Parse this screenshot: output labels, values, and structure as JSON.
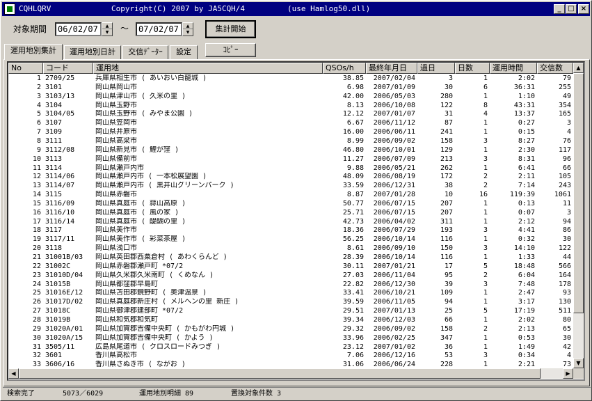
{
  "titlebar": {
    "app": "CQHLQRV",
    "copyright": "Copyright(C) 2007  by JA5CQH/4",
    "use": "(use Hamlog50.dll)",
    "buttons": {
      "minimize": "_",
      "maximize": "□",
      "close": "×"
    }
  },
  "period": {
    "label": "対象期間",
    "from": "06/02/07",
    "sep": "〜",
    "to": "07/02/07",
    "start_button": "集計開始"
  },
  "tabs": [
    "運用地別集計",
    "運用地別日計",
    "交信ﾃﾞｰﾀｰ",
    "設定"
  ],
  "copy_button": "ｺﾋﾟｰ",
  "table": {
    "headers": [
      "No",
      "コード",
      "運用地",
      "QSOs/h",
      "最終年月日",
      "過日",
      "日数",
      "運用時間",
      "交信数"
    ],
    "rows": [
      [
        "1",
        "2709/25",
        "兵庫県相生市 ( あいおい白龍城 )",
        "38.85",
        "2007/02/04",
        "3",
        "1",
        "2:02",
        "79"
      ],
      [
        "2",
        "3101",
        "岡山県岡山市",
        "6.98",
        "2007/01/09",
        "30",
        "6",
        "36:31",
        "255"
      ],
      [
        "3",
        "3103/13",
        "岡山県津山市 ( 久米の里 )",
        "42.00",
        "2006/05/03",
        "280",
        "1",
        "1:10",
        "49"
      ],
      [
        "4",
        "3104",
        "岡山県玉野市",
        "8.13",
        "2006/10/08",
        "122",
        "8",
        "43:31",
        "354"
      ],
      [
        "5",
        "3104/05",
        "岡山県玉野市 ( みやま公園 )",
        "12.12",
        "2007/01/07",
        "31",
        "4",
        "13:37",
        "165"
      ],
      [
        "6",
        "3107",
        "岡山県笠岡市",
        "6.67",
        "2006/11/12",
        "87",
        "1",
        "0:27",
        "3"
      ],
      [
        "7",
        "3109",
        "岡山県井原市",
        "16.00",
        "2006/06/11",
        "241",
        "1",
        "0:15",
        "4"
      ],
      [
        "8",
        "3111",
        "岡山県高梁市",
        "8.99",
        "2006/09/02",
        "158",
        "3",
        "8:27",
        "76"
      ],
      [
        "9",
        "3112/08",
        "岡山県新見市 ( 鯉が窪 )",
        "46.80",
        "2006/10/01",
        "129",
        "1",
        "2:30",
        "117"
      ],
      [
        "10",
        "3113",
        "岡山県備前市",
        "11.27",
        "2006/07/09",
        "213",
        "3",
        "8:31",
        "96"
      ],
      [
        "11",
        "3114",
        "岡山県瀬戸内市",
        "9.88",
        "2006/05/21",
        "262",
        "1",
        "6:41",
        "66"
      ],
      [
        "12",
        "3114/06",
        "岡山県瀬戸内市 ( 一本松展望園 )",
        "48.09",
        "2006/08/19",
        "172",
        "2",
        "2:11",
        "105"
      ],
      [
        "13",
        "3114/07",
        "岡山県瀬戸内市 ( 黒井山グリーンパーク )",
        "33.59",
        "2006/12/31",
        "38",
        "2",
        "7:14",
        "243"
      ],
      [
        "14",
        "3115",
        "岡山県赤磐市",
        "8.87",
        "2007/01/28",
        "10",
        "16",
        "119:39",
        "1061"
      ],
      [
        "15",
        "3116/09",
        "岡山県真庭市 ( 蒜山高原 )",
        "50.77",
        "2006/07/15",
        "207",
        "1",
        "0:13",
        "11"
      ],
      [
        "16",
        "3116/10",
        "岡山県真庭市 ( 風の家 )",
        "25.71",
        "2006/07/15",
        "207",
        "1",
        "0:07",
        "3"
      ],
      [
        "17",
        "3116/14",
        "岡山県真庭市 ( 醍醐の里 )",
        "42.73",
        "2006/04/02",
        "311",
        "1",
        "2:12",
        "94"
      ],
      [
        "18",
        "3117",
        "岡山県美作市",
        "18.36",
        "2006/07/29",
        "193",
        "3",
        "4:41",
        "86"
      ],
      [
        "19",
        "3117/11",
        "岡山県美作市 ( 彩菜茶屋 )",
        "56.25",
        "2006/10/14",
        "116",
        "1",
        "0:32",
        "30"
      ],
      [
        "20",
        "3118",
        "岡山県浅口市",
        "8.61",
        "2006/09/10",
        "150",
        "3",
        "14:10",
        "122"
      ],
      [
        "21",
        "31001B/03",
        "岡山県英田郡西粟倉村 ( あわくらんど )",
        "28.39",
        "2006/10/14",
        "116",
        "1",
        "1:33",
        "44"
      ],
      [
        "22",
        "31002C",
        "岡山県赤磐郡瀬戸町      *07/2",
        "30.11",
        "2007/01/21",
        "17",
        "5",
        "18:48",
        "566"
      ],
      [
        "23",
        "31010D/04",
        "岡山県久米郡久米南町 ( くめなん )",
        "27.03",
        "2006/11/04",
        "95",
        "2",
        "6:04",
        "164"
      ],
      [
        "24",
        "31015B",
        "岡山県都窪郡早島町",
        "22.82",
        "2006/12/30",
        "39",
        "3",
        "7:48",
        "178"
      ],
      [
        "25",
        "31016E/12",
        "岡山県苫田郡鏡野町 ( 奥津温泉 )",
        "33.41",
        "2006/10/21",
        "109",
        "1",
        "2:47",
        "93"
      ],
      [
        "26",
        "31017D/02",
        "岡山県真庭郡新庄村 ( メルヘンの里  新庄 )",
        "39.59",
        "2006/11/05",
        "94",
        "1",
        "3:17",
        "130"
      ],
      [
        "27",
        "31018C",
        "岡山県御津郡建部町      *07/2",
        "29.51",
        "2007/01/13",
        "25",
        "5",
        "17:19",
        "511"
      ],
      [
        "28",
        "31019B",
        "岡山県和気郡和気町",
        "39.34",
        "2006/12/03",
        "66",
        "1",
        "2:02",
        "80"
      ],
      [
        "29",
        "31020A/01",
        "岡山県加賀郡吉備中央町 ( かもがわ円城 )",
        "29.32",
        "2006/09/02",
        "158",
        "2",
        "2:13",
        "65"
      ],
      [
        "30",
        "31020A/15",
        "岡山県加賀郡吉備中央町 ( かよう )",
        "33.96",
        "2006/02/25",
        "347",
        "1",
        "0:53",
        "30"
      ],
      [
        "31",
        "3505/11",
        "広島県尾道市 ( クロスロードみつぎ )",
        "23.12",
        "2007/01/02",
        "36",
        "1",
        "1:49",
        "42"
      ],
      [
        "32",
        "3601",
        "香川県高松市",
        "7.06",
        "2006/12/16",
        "53",
        "3",
        "0:34",
        "4"
      ],
      [
        "33",
        "3606/16",
        "香川県さぬき市 ( ながお )",
        "31.06",
        "2006/06/24",
        "228",
        "1",
        "2:21",
        "73"
      ]
    ]
  },
  "status": {
    "left": "検索完了",
    "count": "5073／6029",
    "detail": "運用地別明細 89",
    "replace": "置換対象件数 3"
  }
}
